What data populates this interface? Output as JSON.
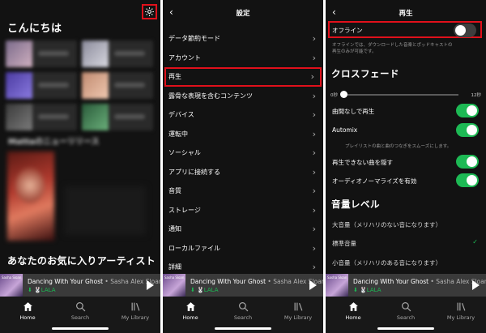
{
  "home": {
    "greeting": "こんにちは",
    "blurred_heading": "Mattaのニューリリース",
    "artists_heading": "あなたのお気に入りアーティスト"
  },
  "player": {
    "album_label": "Sasha Sloan",
    "title": "Dancing With Your Ghost",
    "artist": " • Sasha Alex Sloan",
    "device": "⬇ 🐰LALA"
  },
  "tabs": [
    {
      "label": "Home"
    },
    {
      "label": "Search"
    },
    {
      "label": "My Library"
    }
  ],
  "settings": {
    "back": "‹",
    "title": "設定",
    "items": [
      {
        "label": "データ節約モード"
      },
      {
        "label": "アカウント"
      },
      {
        "label": "再生"
      },
      {
        "label": "露骨な表現を含むコンテンツ"
      },
      {
        "label": "デバイス"
      },
      {
        "label": "運転中"
      },
      {
        "label": "ソーシャル"
      },
      {
        "label": "アプリに接続する"
      },
      {
        "label": "音質"
      },
      {
        "label": "ストレージ"
      },
      {
        "label": "通知"
      },
      {
        "label": "ローカルファイル"
      },
      {
        "label": "詳細"
      }
    ],
    "chevron": "›"
  },
  "playback": {
    "back": "‹",
    "title": "再生",
    "offline_label": "オフライン",
    "offline_on": false,
    "offline_note_1": "オフラインでは、ダウンロードした音楽とポッドキャストの",
    "offline_note_2": "再生のみが可能です。",
    "crossfade_heading": "クロスフェード",
    "crossfade_min": "0秒",
    "crossfade_max": "12秒",
    "crossfade_value": 0,
    "gapless_label": "曲間なしで再生",
    "gapless_on": true,
    "automix_label": "Automix",
    "automix_on": true,
    "automix_note": "プレイリストの曲と曲のつなぎをスムーズにします。",
    "hide_unplayable_label": "再生できない曲を隠す",
    "hide_unplayable_on": true,
    "normalize_label": "オーディオノーマライズを有効",
    "normalize_on": true,
    "volume_heading": "音量レベル",
    "volume_options": [
      {
        "label": "大音量（メリハリのない音になります）",
        "selected": false
      },
      {
        "label": "標準音量",
        "selected": true
      },
      {
        "label": "小音量（メリハリのある音になります）",
        "selected": false
      }
    ],
    "check": "✓"
  },
  "colors": {
    "background": "#121212",
    "accent_green": "#1db954",
    "highlight_red": "#e0101b"
  }
}
